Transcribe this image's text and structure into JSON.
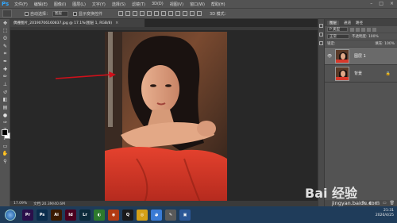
{
  "app": {
    "logo": "Ps",
    "menu": [
      "文件(F)",
      "编辑(E)",
      "图像(I)",
      "图层(L)",
      "文字(Y)",
      "选择(S)",
      "滤镜(T)",
      "3D(D)",
      "视图(V)",
      "窗口(W)",
      "帮助(H)"
    ],
    "window_controls": [
      "–",
      "□",
      "×"
    ]
  },
  "options_bar": {
    "auto_select_label": "自动选择：",
    "auto_select_value": "图层",
    "show_transform_label": "显示变换控件",
    "mode_3d_label": "3D 模式："
  },
  "document": {
    "tab_title": "偶撞图片_20190706160837.jpg @ 17.1%(图层 1, RGB/8)",
    "tab_close": "×",
    "zoom": "17.09%",
    "doc_size": "文档:20.3M/40.6M",
    "arrow_color": "#d0101a"
  },
  "layers_panel": {
    "tabs": [
      "图层",
      "通道",
      "路径"
    ],
    "kind_label": "P 类型",
    "blend_mode": "正常",
    "opacity_label": "不透明度: 100%",
    "lock_label": "锁定:",
    "fill_label": "填充: 100%",
    "layers": [
      {
        "name": "图层 1",
        "visible": true,
        "selected": true
      },
      {
        "name": "背景",
        "visible": false,
        "selected": false,
        "locked": true
      }
    ],
    "footer_icons": [
      "fx",
      "◐",
      "□",
      "▭",
      "🗑"
    ]
  },
  "taskbar": {
    "apps": [
      {
        "label": "Pr",
        "color": "#2a0f4a"
      },
      {
        "label": "Ps",
        "color": "#0b2d4d"
      },
      {
        "label": "Ai",
        "color": "#3a1a00"
      },
      {
        "label": "Id",
        "color": "#4a0020"
      },
      {
        "label": "Lr",
        "color": "#0b2a3a"
      },
      {
        "label": "◐",
        "color": "#2d7a2d"
      },
      {
        "label": "◉",
        "color": "#b23a12"
      },
      {
        "label": "Q",
        "color": "#1a1a1a"
      },
      {
        "label": "◎",
        "color": "#d4a017"
      },
      {
        "label": "◕",
        "color": "#3a7bd5"
      },
      {
        "label": "✎",
        "color": "#5a5a5a"
      },
      {
        "label": "▣",
        "color": "#2b5797"
      }
    ],
    "time": "21:31",
    "date": "2020/4/25"
  },
  "watermark": {
    "text": "Bai 经验",
    "url": "jingyan.baidu.com"
  }
}
